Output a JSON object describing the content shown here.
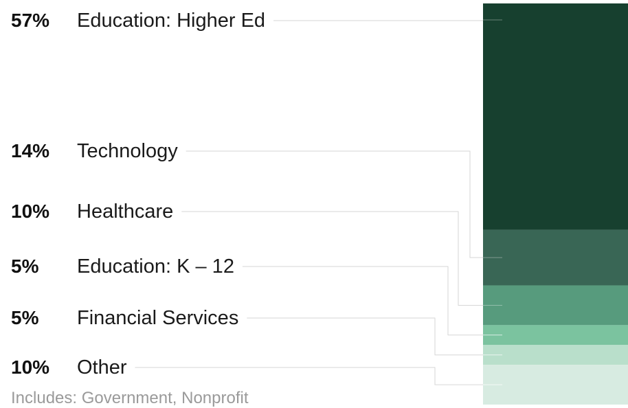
{
  "chart_data": {
    "type": "bar",
    "categories": [
      "Education: Higher Ed",
      "Technology",
      "Healthcare",
      "Education: K – 12",
      "Financial Services",
      "Other"
    ],
    "values": [
      57,
      14,
      10,
      5,
      5,
      10
    ],
    "labels": [
      "57%",
      "14%",
      "10%",
      "5%",
      "5%",
      "10%"
    ],
    "note": "Includes: Government, Nonprofit",
    "colors": [
      "#17402f",
      "#396655",
      "#579b7d",
      "#7bc39f",
      "#b9dfcb",
      "#d7ebe1"
    ],
    "leader_color": "#d6d6d6"
  }
}
